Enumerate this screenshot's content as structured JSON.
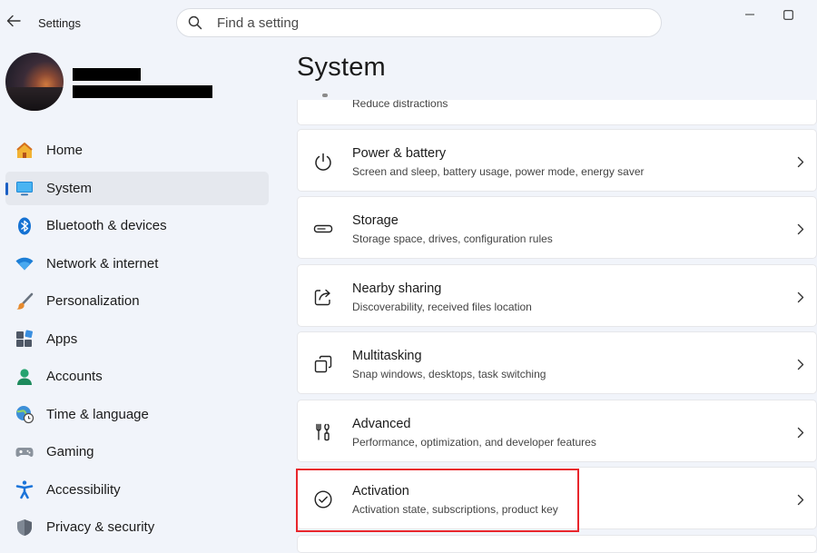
{
  "app": {
    "title": "Settings"
  },
  "search": {
    "placeholder": "Find a setting"
  },
  "profile": {
    "name": "",
    "email": ""
  },
  "nav": {
    "items": [
      {
        "label": "Home",
        "icon": "home-icon"
      },
      {
        "label": "System",
        "icon": "system-icon",
        "selected": true
      },
      {
        "label": "Bluetooth & devices",
        "icon": "bluetooth-icon"
      },
      {
        "label": "Network & internet",
        "icon": "wifi-icon"
      },
      {
        "label": "Personalization",
        "icon": "brush-icon"
      },
      {
        "label": "Apps",
        "icon": "apps-icon"
      },
      {
        "label": "Accounts",
        "icon": "person-icon"
      },
      {
        "label": "Time & language",
        "icon": "globe-clock-icon"
      },
      {
        "label": "Gaming",
        "icon": "gamepad-icon"
      },
      {
        "label": "Accessibility",
        "icon": "accessibility-icon"
      },
      {
        "label": "Privacy & security",
        "icon": "shield-icon"
      }
    ]
  },
  "main": {
    "title": "System",
    "partial_subtitle": "Reduce distractions",
    "cards": [
      {
        "title": "Power & battery",
        "subtitle": "Screen and sleep, battery usage, power mode, energy saver",
        "icon": "power-icon"
      },
      {
        "title": "Storage",
        "subtitle": "Storage space, drives, configuration rules",
        "icon": "storage-icon"
      },
      {
        "title": "Nearby sharing",
        "subtitle": "Discoverability, received files location",
        "icon": "share-icon"
      },
      {
        "title": "Multitasking",
        "subtitle": "Snap windows, desktops, task switching",
        "icon": "multitasking-icon"
      },
      {
        "title": "Advanced",
        "subtitle": "Performance, optimization, and developer features",
        "icon": "advanced-icon"
      },
      {
        "title": "Activation",
        "subtitle": "Activation state, subscriptions, product key",
        "icon": "check-circle-icon",
        "highlighted": true
      }
    ]
  },
  "colors": {
    "accent": "#1b5fc4",
    "highlight": "#e8262c",
    "background": "#f1f4fa"
  }
}
